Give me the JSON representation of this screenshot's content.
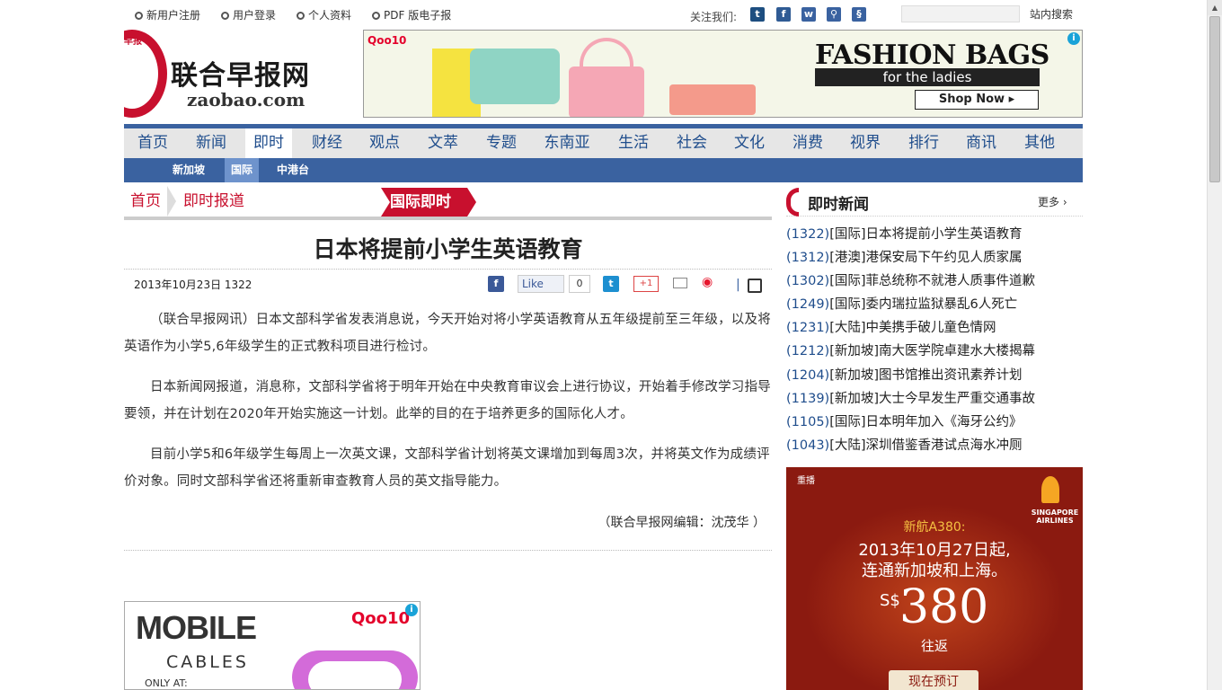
{
  "topbar": {
    "links": [
      "新用户注册",
      "用户登录",
      "个人资料",
      "PDF 版电子报"
    ],
    "follow_label": "关注我们:",
    "social_icons": [
      "twitter-icon",
      "facebook-icon",
      "weibo-icon",
      "zaobao-search-icon",
      "douban-icon"
    ],
    "search_placeholder": "",
    "search_label": "站内搜索"
  },
  "logo": {
    "corner": "早报",
    "cn": "联合早报网",
    "en": "zaobao.com"
  },
  "ad_top": {
    "brand": "Qoo10",
    "title": "FASHION BAGS",
    "subtitle": "for the ladies",
    "cta": "Shop Now ▸"
  },
  "nav": {
    "items": [
      "首页",
      "新闻",
      "即时",
      "财经",
      "观点",
      "文萃",
      "专题",
      "东南亚",
      "生活",
      "社会",
      "文化",
      "消费",
      "视界",
      "排行",
      "商讯",
      "其他"
    ],
    "active_index": 2
  },
  "subnav": {
    "items": [
      "新加坡",
      "国际",
      "中港台"
    ],
    "active_index": 1
  },
  "breadcrumb": {
    "items": [
      "首页",
      "即时报道"
    ],
    "current": "国际即时"
  },
  "article": {
    "title": "日本将提前小学生英语教育",
    "date": "2013年10月23日 1322",
    "like_label": "Like",
    "like_count": "0",
    "gplus_label": "+1",
    "paragraphs": [
      "（联合早报网讯）日本文部科学省发表消息说，今天开始对将小学英语教育从五年级提前至三年级，以及将英语作为小学5,6年级学生的正式教科项目进行检讨。",
      "日本新闻网报道，消息称，文部科学省将于明年开始在中央教育审议会上进行协议，开始着手修改学习指导要领，并在计划在2020年开始实施这一计划。此举的目的在于培养更多的国际化人才。",
      "目前小学5和6年级学生每周上一次英文课，文部科学省计划将英文课增加到每周3次，并将英文作为成绩评价对象。同时文部科学省还将重新审查教育人员的英文指导能力。"
    ],
    "editor": "（联合早报网编辑：沈茂华 ）"
  },
  "ad_bottom": {
    "line1": "MOBILE",
    "line2": "CABLES",
    "line3": "ONLY AT:",
    "brand": "Qoo10"
  },
  "sidebar": {
    "title": "即时新闻",
    "more": "更多 ›",
    "items": [
      {
        "count": "(1322)",
        "text": "[国际]日本将提前小学生英语教育"
      },
      {
        "count": "(1312)",
        "text": "[港澳]港保安局下午约见人质家属"
      },
      {
        "count": "(1302)",
        "text": "[国际]菲总统称不就港人质事件道歉"
      },
      {
        "count": "(1249)",
        "text": "[国际]委内瑞拉监狱暴乱6人死亡"
      },
      {
        "count": "(1231)",
        "text": "[大陆]中美携手破儿童色情网"
      },
      {
        "count": "(1212)",
        "text": "[新加坡]南大医学院卓建水大楼揭幕"
      },
      {
        "count": "(1204)",
        "text": "[新加坡]图书馆推出资讯素养计划"
      },
      {
        "count": "(1139)",
        "text": "[新加坡]大士今早发生严重交通事故"
      },
      {
        "count": "(1105)",
        "text": "[国际]日本明年加入《海牙公约》"
      },
      {
        "count": "(1043)",
        "text": "[大陆]深圳借鉴香港试点海水冲厕"
      }
    ]
  },
  "ad_side": {
    "replay": "重播",
    "airline": "SINGAPORE AIRLINES",
    "line1": "新航A380:",
    "line2": "2013年10月27日起,",
    "line3": "连通新加坡和上海。",
    "currency": "S$",
    "price": "380",
    "roundtrip": "往返",
    "cta": "现在预订"
  },
  "colors": {
    "nav_blue": "#3a62a0",
    "brand_red": "#c8102e",
    "link_blue": "#1f4d8c"
  }
}
